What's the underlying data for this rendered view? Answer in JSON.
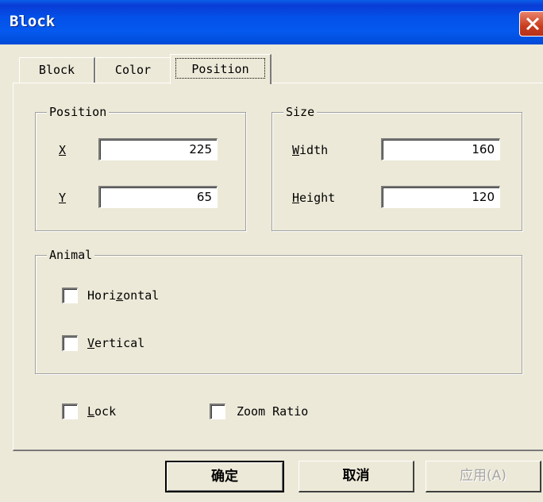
{
  "window": {
    "title": "Block"
  },
  "tabs": [
    {
      "label": "Block",
      "active": false
    },
    {
      "label": "Color",
      "active": false
    },
    {
      "label": "Position",
      "active": true
    }
  ],
  "position_group": {
    "title": "Position",
    "x": {
      "label": "X",
      "value": "225"
    },
    "y": {
      "label": "Y",
      "value": "65"
    }
  },
  "size_group": {
    "title": "Size",
    "width": {
      "label_underlined": "W",
      "label_rest": "idth",
      "value": "160"
    },
    "height": {
      "label_underlined": "H",
      "label_rest": "eight",
      "value": "120"
    }
  },
  "animal_group": {
    "title": "Animal",
    "horizontal": {
      "label_pre": "Hori",
      "label_underlined": "z",
      "label_post": "ontal",
      "checked": false
    },
    "vertical": {
      "label_underlined": "V",
      "label_post": "ertical",
      "checked": false
    }
  },
  "lock": {
    "label_underlined": "L",
    "label_post": "ock",
    "checked": false
  },
  "zoom_ratio": {
    "label": "Zoom Ratio",
    "checked": false
  },
  "buttons": {
    "ok": "确定",
    "cancel": "取消",
    "apply": "应用(A)"
  },
  "colors": {
    "titlebar": "#0351e8",
    "face": "#ece9d8",
    "close": "#c93d1d"
  }
}
